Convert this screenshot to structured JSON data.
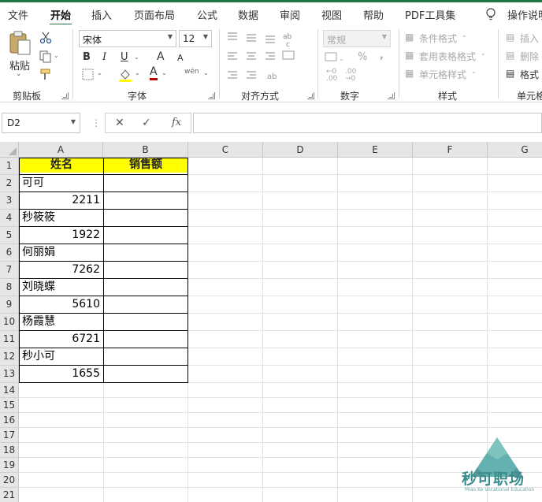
{
  "menu": {
    "items": [
      "文件",
      "开始",
      "插入",
      "页面布局",
      "公式",
      "数据",
      "审阅",
      "视图",
      "帮助",
      "PDF工具集",
      "操作说明"
    ],
    "active_index": 1
  },
  "ribbon": {
    "clipboard": {
      "paste_label": "粘贴",
      "group_label": "剪贴板"
    },
    "font": {
      "font_name": "宋体",
      "font_size": "12",
      "bold": "B",
      "italic": "I",
      "underline": "U",
      "grow": "A",
      "shrink": "A",
      "font_color_letter": "A",
      "phonetic": "wén",
      "group_label": "字体"
    },
    "alignment": {
      "group_label": "对齐方式"
    },
    "number": {
      "format": "常规",
      "percent": "%",
      "comma": ",",
      "group_label": "数字"
    },
    "styles": {
      "conditional": "条件格式",
      "table_format": "套用表格格式",
      "cell_styles": "单元格样式",
      "group_label": "样式"
    },
    "cells": {
      "insert": "插入",
      "delete": "删除",
      "format": "格式",
      "group_label": "单元格"
    }
  },
  "formula_bar": {
    "name_box": "D2",
    "fx": "fx",
    "content": ""
  },
  "columns": [
    "A",
    "B",
    "C",
    "D",
    "E",
    "F",
    "G"
  ],
  "rows": [
    "1",
    "2",
    "3",
    "4",
    "5",
    "6",
    "7",
    "8",
    "9",
    "10",
    "11",
    "12",
    "13",
    "14",
    "15",
    "16",
    "17",
    "18",
    "19",
    "20",
    "21"
  ],
  "table": {
    "header": [
      "姓名",
      "销售额"
    ],
    "cells_a": [
      "可可",
      "2211",
      "秒筱筱",
      "1922",
      "何丽娟",
      "7262",
      "刘晓蝶",
      "5610",
      "杨霞慧",
      "6721",
      "秒小可",
      "1655"
    ]
  },
  "watermark": {
    "text": "秒可职场",
    "sub": "Miao Ke Vocational Education"
  },
  "colors": {
    "accent": "#217346",
    "header_fill": "#ffff00",
    "watermark": "#3a8d8d"
  }
}
